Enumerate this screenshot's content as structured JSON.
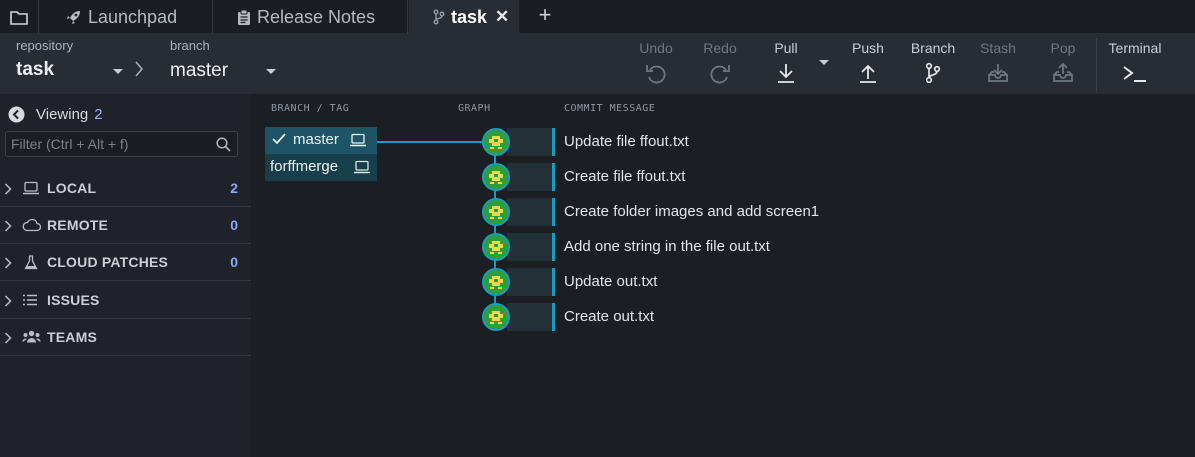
{
  "tabs": [
    {
      "label": "",
      "icon": "folder-icon"
    },
    {
      "label": "Launchpad",
      "icon": "rocket-icon"
    },
    {
      "label": "Release Notes",
      "icon": "clipboard-icon"
    },
    {
      "label": "task",
      "icon": "branch-icon",
      "active": true
    }
  ],
  "tab_close": "✕",
  "tab_add": "+",
  "toolbar": {
    "repository_label": "repository",
    "repository_value": "task",
    "branch_label": "branch",
    "branch_value": "master",
    "buttons": [
      {
        "label": "Undo",
        "icon": "undo-icon",
        "enabled": false
      },
      {
        "label": "Redo",
        "icon": "redo-icon",
        "enabled": false
      },
      {
        "label": "Pull",
        "icon": "pull-icon",
        "enabled": true
      },
      {
        "label": "Push",
        "icon": "push-icon",
        "enabled": true
      },
      {
        "label": "Branch",
        "icon": "branch-icon",
        "enabled": true
      },
      {
        "label": "Stash",
        "icon": "stash-icon",
        "enabled": false
      },
      {
        "label": "Pop",
        "icon": "pop-icon",
        "enabled": false
      },
      {
        "label": "Terminal",
        "icon": "terminal-icon",
        "enabled": true
      }
    ]
  },
  "sidebar": {
    "viewing_label": "Viewing",
    "viewing_count": "2",
    "filter_placeholder": "Filter (Ctrl + Alt + f)",
    "sections": [
      {
        "title": "LOCAL",
        "count": "2",
        "icon": "laptop-icon"
      },
      {
        "title": "REMOTE",
        "count": "0",
        "icon": "cloud-icon"
      },
      {
        "title": "CLOUD PATCHES",
        "count": "0",
        "icon": "flask-icon"
      },
      {
        "title": "ISSUES",
        "count": "",
        "icon": "list-icon"
      },
      {
        "title": "TEAMS",
        "count": "",
        "icon": "users-icon"
      }
    ]
  },
  "graph": {
    "columns": {
      "branch_tag": "BRANCH / TAG",
      "graph": "GRAPH",
      "commit_message": "COMMIT MESSAGE"
    },
    "branches": [
      {
        "name": "master",
        "checked": true
      },
      {
        "name": "forffmerge",
        "checked": false
      }
    ],
    "commits": [
      "Update file ffout.txt",
      "Create file ffout.txt",
      "Create folder images and add screen1",
      "Add one string in the file out.txt",
      "Update out.txt",
      "Create out.txt"
    ]
  },
  "colors": {
    "accent": "#1b9bbd",
    "branch_bg": "#1e5566",
    "count_blue": "#8fa6ff",
    "avatar_green": "#2d9e3a"
  }
}
